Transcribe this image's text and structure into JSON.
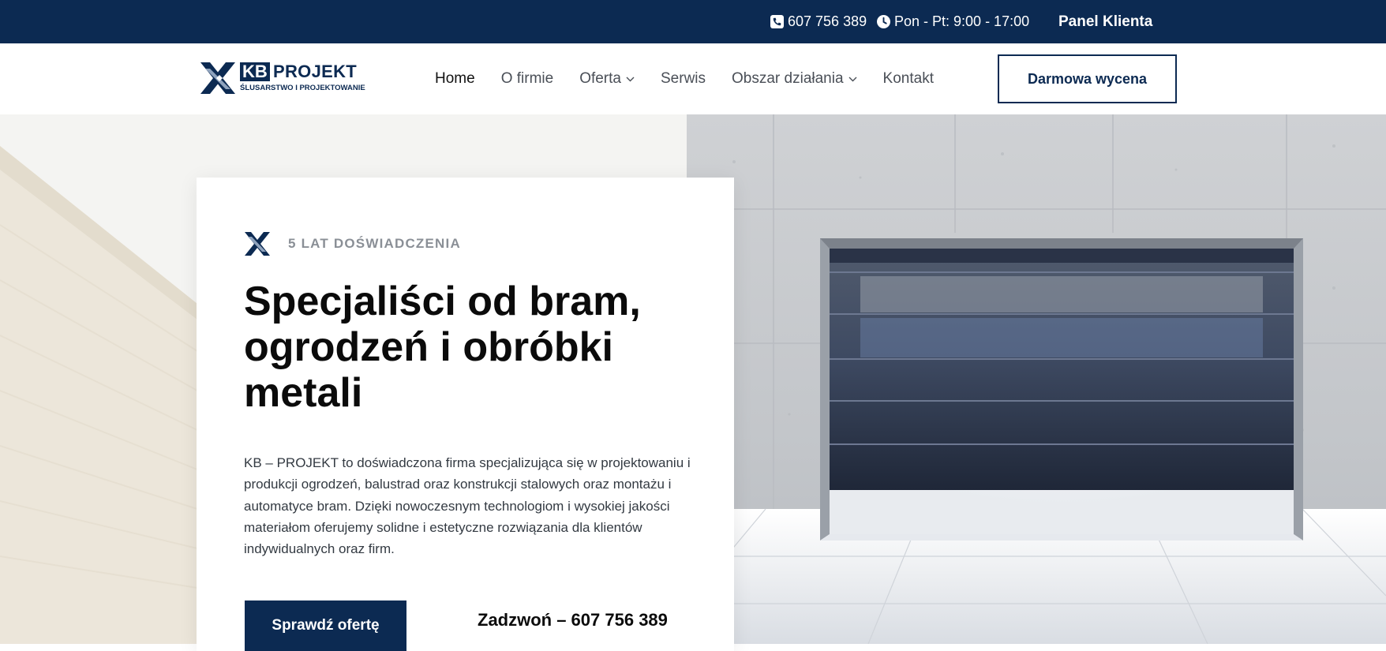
{
  "topbar": {
    "phone": "607 756 389",
    "hours": "Pon - Pt: 9:00 - 17:00",
    "panel_label": "Panel Klienta",
    "phone_icon": "phone-icon",
    "clock_icon": "clock-icon"
  },
  "header": {
    "logo": {
      "kb": "KB",
      "projekt": "PROJEKT",
      "tagline": "ŚLUSARSTWO I PROJEKTOWANIE"
    },
    "nav": [
      {
        "label": "Home",
        "active": true,
        "has_dropdown": false
      },
      {
        "label": "O firmie",
        "active": false,
        "has_dropdown": false
      },
      {
        "label": "Oferta",
        "active": false,
        "has_dropdown": true
      },
      {
        "label": "Serwis",
        "active": false,
        "has_dropdown": false
      },
      {
        "label": "Obszar działania",
        "active": false,
        "has_dropdown": true
      },
      {
        "label": "Kontakt",
        "active": false,
        "has_dropdown": false
      }
    ],
    "cta_label": "Darmowa wycena"
  },
  "hero": {
    "eyebrow": "5 LAT DOŚWIADCZENIA",
    "title": "Specjaliści od bram, ogrodzeń i obróbki metali",
    "text": "KB – PROJEKT to doświadczona firma specjalizująca się w projektowaniu i produkcji ogrodzeń, balustrad oraz konstrukcji stalowych oraz montażu i automatyce bram. Dzięki nowoczesnym technologiom i wysokiej jakości materiałom oferujemy solidne i estetyczne rozwiązania dla klientów indywidualnych oraz firm.",
    "primary_button": "Sprawdź ofertę",
    "call_link": "Zadzwoń – 607 756 389"
  },
  "colors": {
    "brand_navy": "#0c2a52",
    "text_dark": "#0b0b0b",
    "muted": "#8a8f96"
  }
}
